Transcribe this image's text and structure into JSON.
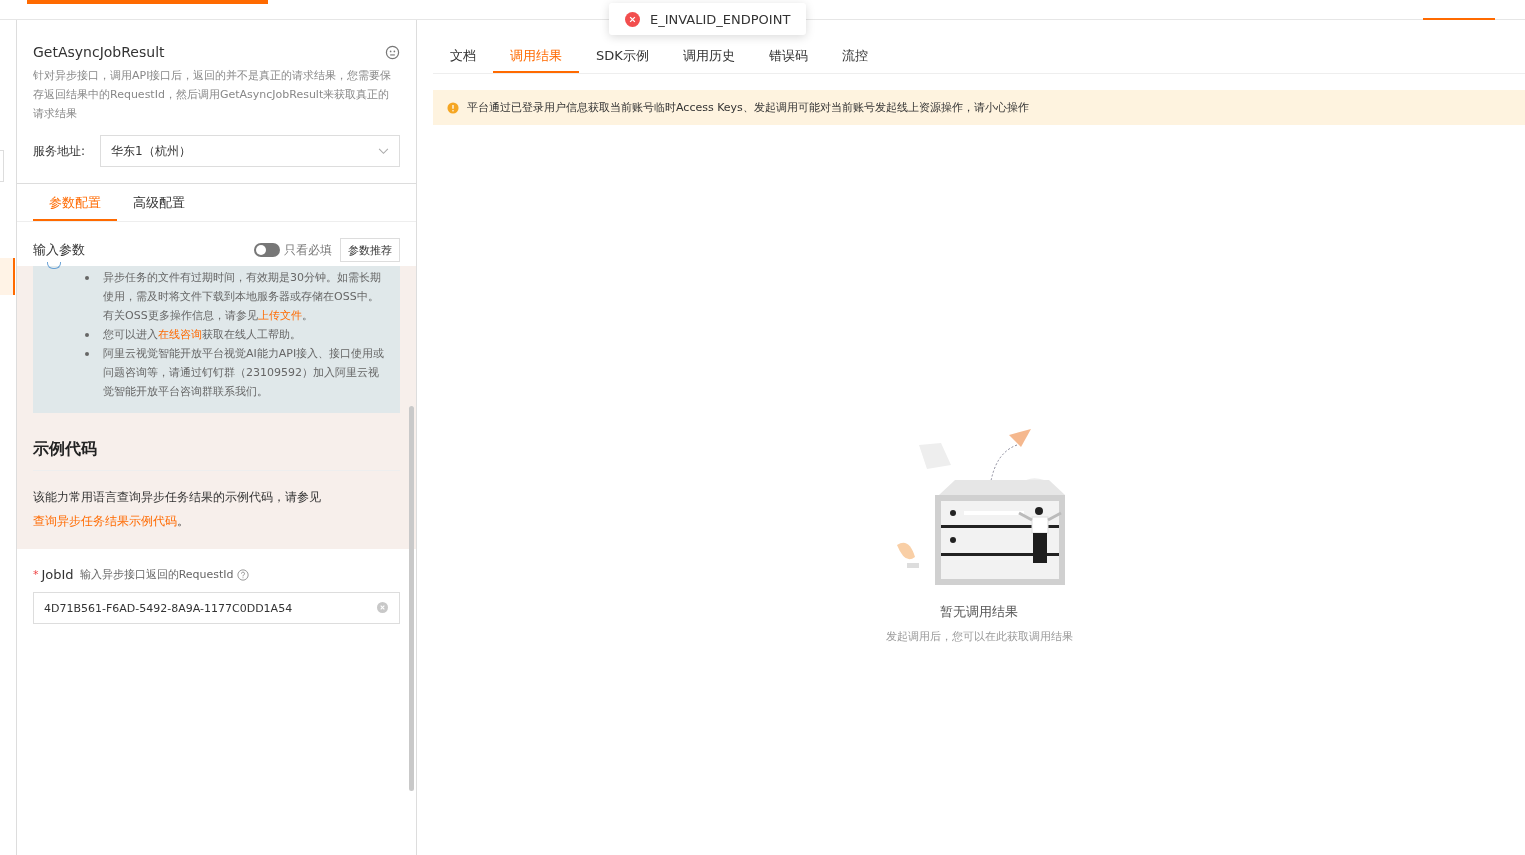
{
  "api": {
    "name": "GetAsyncJobResult",
    "description": "针对异步接口，调用API接口后，返回的并不是真正的请求结果，您需要保存返回结果中的RequestId，然后调用GetAsyncJobResult来获取真正的请求结果"
  },
  "endpoint": {
    "label": "服务地址:",
    "value": "华东1（杭州）"
  },
  "config_tabs": [
    {
      "label": "参数配置",
      "selected": true
    },
    {
      "label": "高级配置",
      "selected": false
    }
  ],
  "input_params": {
    "title": "输入参数",
    "required_only": {
      "label": "只看必填",
      "on": false
    },
    "recommend_button": "参数推荐"
  },
  "notes": [
    [
      {
        "kind": "text",
        "text": "异步任务的文件有过期时间，有效期是30分钟。如需长期使用，需及时将文件下载到本地服务器或存储在OSS中。有关OSS更多操作信息，请参见"
      },
      {
        "kind": "link",
        "text": "上传文件"
      },
      {
        "kind": "text",
        "text": "。"
      }
    ],
    [
      {
        "kind": "text",
        "text": "您可以进入"
      },
      {
        "kind": "link",
        "text": "在线咨询"
      },
      {
        "kind": "text",
        "text": "获取在线人工帮助。"
      }
    ],
    [
      {
        "kind": "text",
        "text": "阿里云视觉智能开放平台视觉AI能力API接入、接口使用或问题咨询等，请通过钉钉群（23109592）加入阿里云视觉智能开放平台咨询群联系我们。"
      }
    ]
  ],
  "sample_code": {
    "title": "示例代码",
    "text": [
      {
        "kind": "text",
        "text": "该能力常用语言查询异步任务结果的示例代码，请参见"
      },
      {
        "kind": "link",
        "text": "查询异步任务结果示例代码"
      },
      {
        "kind": "text",
        "text": "。"
      }
    ]
  },
  "job_id": {
    "required_mark": "*",
    "label": "JobId",
    "hint": "输入异步接口返回的RequestId",
    "value": "4D71B561-F6AD-5492-8A9A-1177C0DD1A54"
  },
  "toast": {
    "message": "E_INVALID_ENDPOINT"
  },
  "result_tabs": [
    {
      "label": "文档",
      "selected": false
    },
    {
      "label": "调用结果",
      "selected": true
    },
    {
      "label": "SDK示例",
      "selected": false
    },
    {
      "label": "调用历史",
      "selected": false
    },
    {
      "label": "错误码",
      "selected": false
    },
    {
      "label": "流控",
      "selected": false
    }
  ],
  "warning": "平台通过已登录用户信息获取当前账号临时Access Keys、发起调用可能对当前账号发起线上资源操作，请小心操作",
  "empty_state": {
    "title": "暂无调用结果",
    "subtitle": "发起调用后，您可以在此获取调用结果"
  }
}
